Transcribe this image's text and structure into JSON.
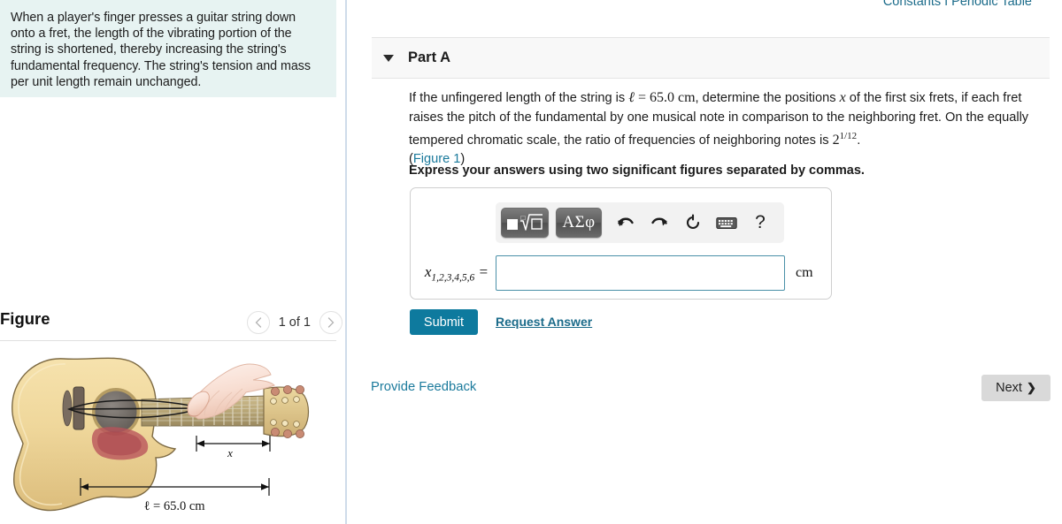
{
  "top_links": {
    "constants": "Constants I Periodic Table"
  },
  "left_panel": {
    "intro": "When a player's finger presses a guitar string down onto a fret, the length of the vibrating portion of the string is shortened, thereby increasing the string's fundamental frequency. The string's tension and mass per unit length remain unchanged.",
    "figure_title": "Figure",
    "figure_count": "1 of 1",
    "prev_icon": "chevron-left-icon",
    "next_icon": "chevron-right-icon",
    "figure": {
      "x_label": "x",
      "length_label": "ℓ = 65.0 cm"
    }
  },
  "part": {
    "caret_icon": "caret-down-icon",
    "label": "Part A",
    "question_pre": "If the unfingered length of the string is ",
    "question_l": "ℓ",
    "question_eq": " = ",
    "question_len": "65.0 cm",
    "question_mid": ", determine the positions ",
    "question_x": "x",
    "question_post": " of the first six frets, if each fret raises the pitch of the fundamental by one musical note in comparison to the neighboring fret. On the equally tempered chromatic scale, the ratio of frequencies of neighboring notes is ",
    "question_ratio_base": "2",
    "question_ratio_exp": "1/12",
    "question_end": ".",
    "figure_link_open": "(",
    "figure_link": "Figure 1",
    "figure_link_close": ")",
    "instruction": "Express your answers using two significant figures separated by commas."
  },
  "answer": {
    "toolbar": {
      "math_template": "math-template-icon",
      "greek": "ΑΣφ",
      "undo": "undo-icon",
      "redo": "redo-icon",
      "reset": "reset-icon",
      "keyboard": "keyboard-icon",
      "help": "?"
    },
    "label_var": "x",
    "label_sub": "1,2,3,4,5,6",
    "label_eq": " =",
    "value": "",
    "placeholder": "",
    "unit": "cm"
  },
  "actions": {
    "submit": "Submit",
    "request_answer": "Request Answer",
    "provide_feedback": "Provide Feedback",
    "next": "Next",
    "next_chevron": "❯"
  },
  "colors": {
    "accent_teal": "#0e7a9e",
    "link_blue": "#1b7a9c",
    "intro_bg": "#e7f3f2",
    "input_border": "#4a90a8",
    "next_bg": "#d9d9d9"
  }
}
